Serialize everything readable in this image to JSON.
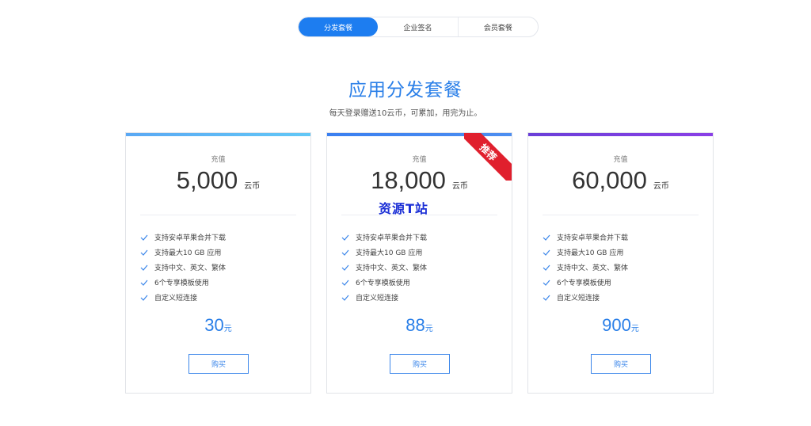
{
  "tabs": [
    {
      "label": "分发套餐",
      "active": true
    },
    {
      "label": "企业签名",
      "active": false
    },
    {
      "label": "会员套餐",
      "active": false
    }
  ],
  "header": {
    "title": "应用分发套餐",
    "subtitle": "每天登录赠送10云币，可累加，用完为止。"
  },
  "colors": {
    "accent": "#1d7df0",
    "ribbon": "#e01f2d",
    "card1_bar": "#5fb3f5",
    "card2_bar": "#3f86ee",
    "card3_bar": "#7a3fe0"
  },
  "plans": [
    {
      "label": "充值",
      "amount": "5,000",
      "unit": "云币",
      "features": [
        "支持安卓苹果合并下载",
        "支持最大10 GB 应用",
        "支持中文、英文、繁体",
        "6个专享模板使用",
        "自定义短连接"
      ],
      "price": "30",
      "price_unit": "元",
      "button": "购买"
    },
    {
      "label": "充值",
      "amount": "18,000",
      "unit": "云币",
      "badge": "推荐",
      "features": [
        "支持安卓苹果合并下载",
        "支持最大10 GB 应用",
        "支持中文、英文、繁体",
        "6个专享模板使用",
        "自定义短连接"
      ],
      "price": "88",
      "price_unit": "元",
      "button": "购买"
    },
    {
      "label": "充值",
      "amount": "60,000",
      "unit": "云币",
      "features": [
        "支持安卓苹果合并下载",
        "支持最大10 GB 应用",
        "支持中文、英文、繁体",
        "6个专享模板使用",
        "自定义短连接"
      ],
      "price": "900",
      "price_unit": "元",
      "button": "购买"
    }
  ],
  "watermark": "资源T站"
}
